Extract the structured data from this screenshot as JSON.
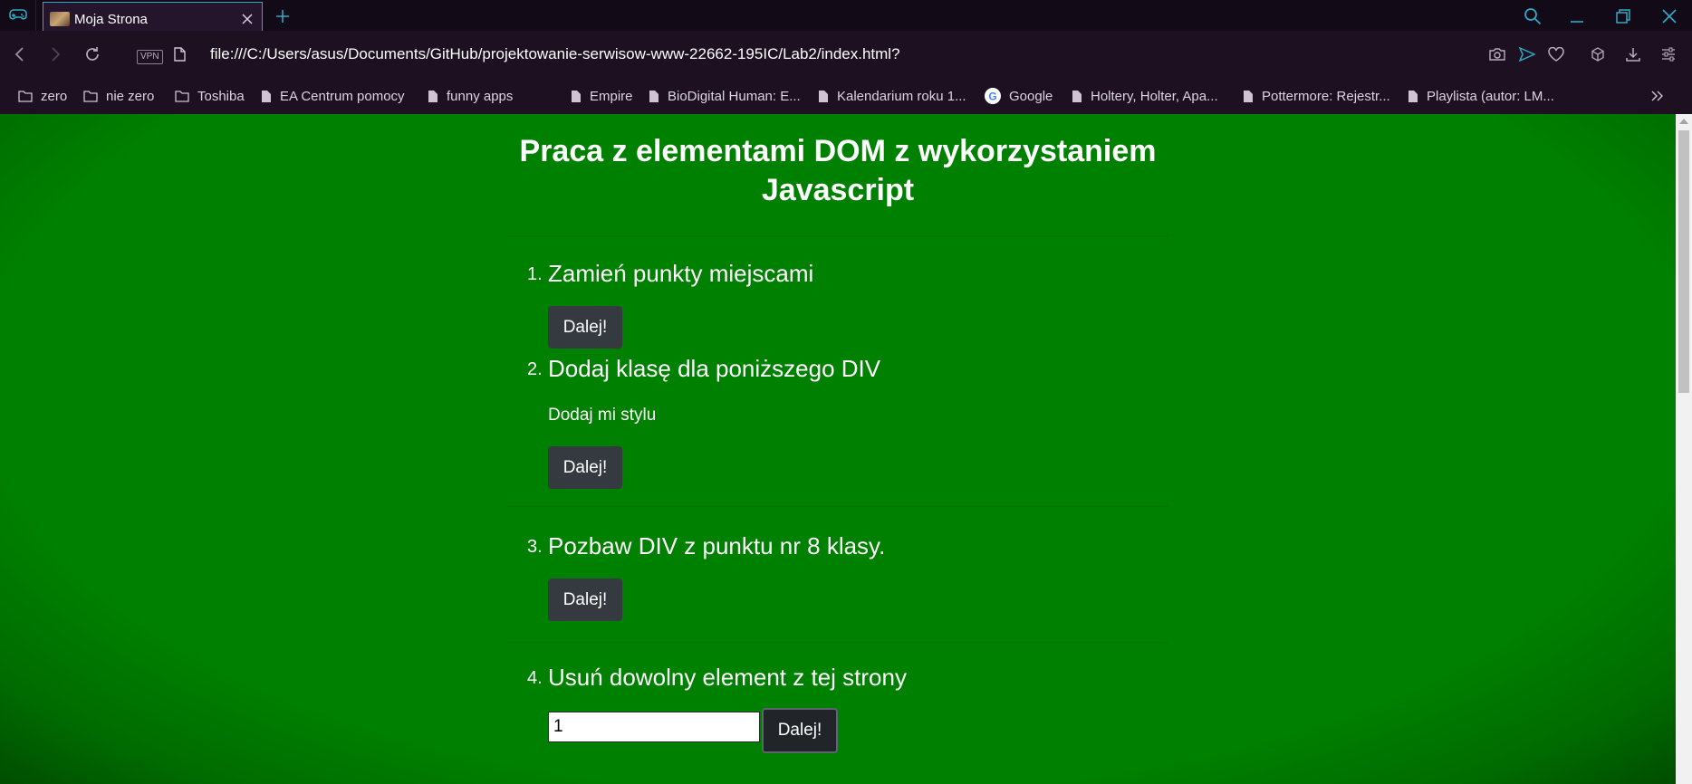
{
  "browser": {
    "tab_title": "Moja Strona",
    "vpn_label": "VPN",
    "url": "file:///C:/Users/asus/Documents/GitHub/projektowanie-serwisow-www-22662-195IC/Lab2/index.html?",
    "accent_color": "#2fa9c4",
    "bookmarks": [
      {
        "label": "zero",
        "icon": "folder-icon"
      },
      {
        "label": "nie zero",
        "icon": "folder-icon"
      },
      {
        "label": "Toshiba",
        "icon": "folder-icon"
      },
      {
        "label": "EA Centrum pomocy",
        "icon": "page-icon"
      },
      {
        "label": "funny apps",
        "icon": "page-icon"
      },
      {
        "label": "Empire",
        "icon": "page-icon"
      },
      {
        "label": "BioDigital Human: E...",
        "icon": "page-icon"
      },
      {
        "label": "Kalendarium roku 1...",
        "icon": "page-icon"
      },
      {
        "label": "Google",
        "icon": "google-icon"
      },
      {
        "label": "Holtery, Holter, Apa...",
        "icon": "page-icon"
      },
      {
        "label": "Pottermore: Rejestr...",
        "icon": "page-icon"
      },
      {
        "label": "Playlista (autor: LM...",
        "icon": "page-icon"
      }
    ]
  },
  "page": {
    "title": "Praca z elementami DOM z wykorzystaniem Javascript",
    "background_color": "#008000",
    "tasks": [
      {
        "number": "1.",
        "text": "Zamień punkty miejscami",
        "button": "Dalej!"
      },
      {
        "number": "2.",
        "text": "Dodaj klasę dla poniższego DIV",
        "div_text": "Dodaj mi stylu",
        "button": "Dalej!"
      },
      {
        "number": "3.",
        "text": "Pozbaw DIV z punktu nr 8 klasy.",
        "button": "Dalej!"
      },
      {
        "number": "4.",
        "text": "Usuń dowolny element z tej strony",
        "input_value": "1",
        "button": "Dalej!"
      }
    ]
  }
}
